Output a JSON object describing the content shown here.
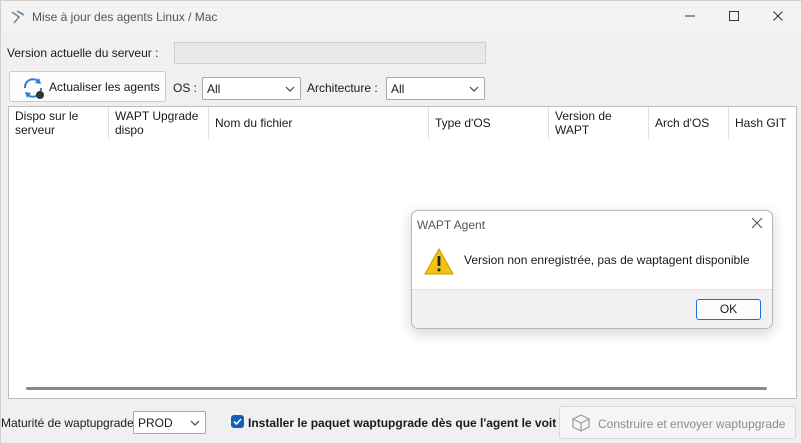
{
  "window": {
    "title": "Mise à jour des agents Linux / Mac"
  },
  "server": {
    "label": "Version actuelle du serveur :",
    "value": ""
  },
  "toolbar": {
    "refresh_label": "Actualiser les agents",
    "os_label": "OS :",
    "os_value": "All",
    "arch_label": "Architecture :",
    "arch_value": "All"
  },
  "grid": {
    "columns": [
      "Dispo sur le serveur",
      "WAPT Upgrade dispo",
      "Nom du fichier",
      "Type d'OS",
      "Version de WAPT",
      "Arch d'OS",
      "Hash GIT"
    ]
  },
  "bottom": {
    "maturity_label": "Maturité de waptupgrade",
    "maturity_value": "PROD",
    "install_label": "Installer le paquet waptupgrade dès que l'agent le voit",
    "install_checked": true,
    "build_label": "Construire et envoyer waptupgrade"
  },
  "dialog": {
    "title": "WAPT Agent",
    "message": "Version non enregistrée, pas de waptagent disponible",
    "ok_label": "OK"
  },
  "colors": {
    "accent": "#1460b8",
    "warning": "#f5c211"
  }
}
